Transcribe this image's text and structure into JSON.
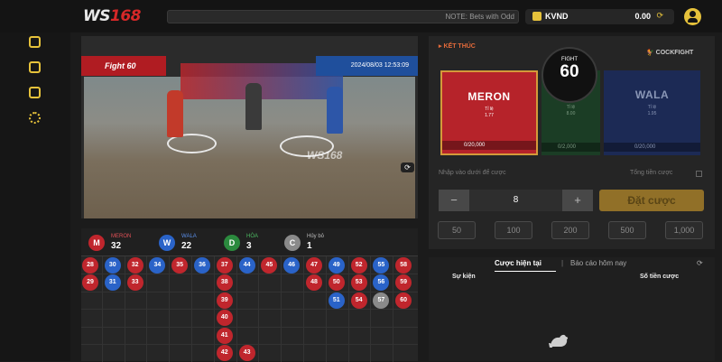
{
  "header": {
    "logo": "WS",
    "logo_num": "168",
    "ticker": "NOTE: Bets with Odd",
    "currency": "KVND",
    "balance": "0.00"
  },
  "sidebar": {
    "icons": [
      "video-icon",
      "document-stack-icon",
      "list-icon",
      "gear-icon"
    ]
  },
  "video": {
    "fight_label": "Fight 60",
    "datetime": "2024/08/03 12:53:09",
    "watermark": "WS168"
  },
  "stats": [
    {
      "letter": "M",
      "label": "MERON",
      "count": "32",
      "color": "#c0262d",
      "label_color": "#e05056"
    },
    {
      "letter": "W",
      "label": "WALA",
      "count": "22",
      "color": "#2a63c8",
      "label_color": "#5a8ee8"
    },
    {
      "letter": "D",
      "label": "HÒA",
      "count": "3",
      "color": "#2b8a3e",
      "label_color": "#4cba62"
    },
    {
      "letter": "C",
      "label": "Hủy bỏ",
      "count": "1",
      "color": "#8a8a8a",
      "label_color": "#bbbbbb"
    }
  ],
  "results_grid": [
    {
      "v": "28",
      "c": "r"
    },
    {
      "v": "29",
      "c": "r"
    },
    {
      "v": "30",
      "c": "b"
    },
    {
      "v": "31",
      "c": "b"
    },
    {
      "v": "32",
      "c": "r"
    },
    {
      "v": "33",
      "c": "r"
    },
    {
      "v": "34",
      "c": "b"
    },
    {
      "v": "35",
      "c": "r"
    },
    {
      "v": "36",
      "c": "b"
    },
    {
      "v": "37",
      "c": "r"
    },
    {
      "v": "38",
      "c": "r"
    },
    {
      "v": "39",
      "c": "r"
    },
    {
      "v": "40",
      "c": "r"
    },
    {
      "v": "41",
      "c": "r"
    },
    {
      "v": "42",
      "c": "r"
    },
    {
      "v": "43",
      "c": "r"
    },
    {
      "v": "44",
      "c": "b"
    },
    {
      "v": "45",
      "c": "r"
    },
    {
      "v": "46",
      "c": "b"
    },
    {
      "v": "47",
      "c": "r"
    },
    {
      "v": "48",
      "c": "r"
    },
    {
      "v": "49",
      "c": "b"
    },
    {
      "v": "50",
      "c": "r"
    },
    {
      "v": "51",
      "c": "b"
    },
    {
      "v": "52",
      "c": "r"
    },
    {
      "v": "53",
      "c": "r"
    },
    {
      "v": "54",
      "c": "r"
    },
    {
      "v": "55",
      "c": "b"
    },
    {
      "v": "56",
      "c": "b"
    },
    {
      "v": "57",
      "c": "g"
    },
    {
      "v": "58",
      "c": "r"
    },
    {
      "v": "59",
      "c": "r"
    },
    {
      "v": "60",
      "c": "r"
    }
  ],
  "bet_panel": {
    "result_label": "KẾT THÚC",
    "brand": "COCKFIGHT",
    "fight_word": "FIGHT",
    "fight_number": "60",
    "meron": {
      "name": "MERON",
      "rate_label": "Tỉ lệ",
      "rate": "1.77",
      "total": "0/20,000"
    },
    "hoa": {
      "name": "HÒA",
      "rate_label": "Tỉ lệ",
      "rate": "8.00",
      "total": "0/2,000"
    },
    "wala": {
      "name": "WALA",
      "rate_label": "Tỉ lệ",
      "rate": "1.95",
      "total": "0/20,000"
    },
    "input_hint": "Nhập vào dưới để cược",
    "total_bet_label": "Tổng tiền cược",
    "amount": "8",
    "minus": "−",
    "plus": "+",
    "place_bet": "Đặt cược",
    "chips": [
      "50",
      "100",
      "200",
      "500",
      "1,000"
    ]
  },
  "bets": {
    "tab_current": "Cược hiện tại",
    "separator": "|",
    "tab_report": "Báo cáo hôm nay",
    "col_event": "Sự kiện",
    "col_amount": "Số tiền cược"
  },
  "colors": {
    "red": "#c0262d",
    "blue": "#2a63c8",
    "green": "#2b8a3e",
    "gray": "#8a8a8a",
    "accent": "#e6c23b"
  }
}
